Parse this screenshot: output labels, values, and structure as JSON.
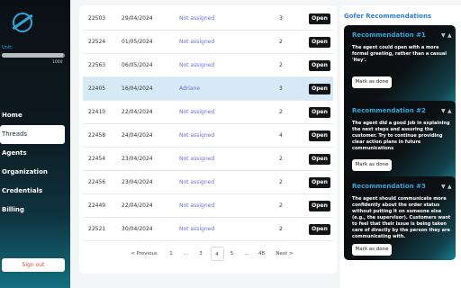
{
  "sidebar": {
    "unit_label": "Unit:",
    "unit_fill": 0.97,
    "unit_max": "1000",
    "items": [
      {
        "label": "Home",
        "active": false
      },
      {
        "label": "Threads",
        "active": true
      },
      {
        "label": "Agents",
        "active": false
      },
      {
        "label": "Organization",
        "active": false
      },
      {
        "label": "Credentials",
        "active": false
      },
      {
        "label": "Billing",
        "active": false
      }
    ],
    "signout_label": "Sign out"
  },
  "table": {
    "open_label": "Open",
    "rows": [
      {
        "id": "22503",
        "date": "29/04/2024",
        "agent": "Not assigned",
        "count": "3",
        "highlight": false
      },
      {
        "id": "22524",
        "date": "01/05/2024",
        "agent": "Not assigned",
        "count": "2",
        "highlight": false
      },
      {
        "id": "22563",
        "date": "06/05/2024",
        "agent": "Not assigned",
        "count": "2",
        "highlight": false
      },
      {
        "id": "22405",
        "date": "16/04/2024",
        "agent": "Adriane",
        "count": "3",
        "highlight": true
      },
      {
        "id": "22410",
        "date": "22/04/2024",
        "agent": "Not assigned",
        "count": "2",
        "highlight": false
      },
      {
        "id": "22458",
        "date": "24/04/2024",
        "agent": "Not assigned",
        "count": "4",
        "highlight": false
      },
      {
        "id": "22454",
        "date": "23/04/2024",
        "agent": "Not assigned",
        "count": "2",
        "highlight": false
      },
      {
        "id": "22456",
        "date": "23/04/2024",
        "agent": "Not assigned",
        "count": "2",
        "highlight": false
      },
      {
        "id": "22449",
        "date": "22/04/2024",
        "agent": "Not assigned",
        "count": "2",
        "highlight": false
      },
      {
        "id": "22521",
        "date": "30/04/2024",
        "agent": "Not assigned",
        "count": "2",
        "highlight": false
      }
    ]
  },
  "pagination": {
    "previous": "< Previous",
    "next": "Next >",
    "pages": [
      "1",
      "...",
      "3",
      "4",
      "5",
      "...",
      "48"
    ],
    "current": "4"
  },
  "recommendations": {
    "heading": "Gofer Recommendations",
    "button_label": "Mark as done",
    "items": [
      {
        "title": "Recommendation #1",
        "text": "The agent could open with a more formal greeting, rather than a casual 'Hey'."
      },
      {
        "title": "Recommendation #2",
        "text": "The agent did a good job in explaining the next steps and assuring the customer. Try to continue providing clear action plans in future communications"
      },
      {
        "title": "Recommendation #3",
        "text": "The agent should communicate more confidently about the order status without putting it on someone else (e.g., the supervisor). Customers want to feel that their issue is being taken care of directly by the person they are communicating with."
      }
    ]
  },
  "colors": {
    "accent": "#2aa9df",
    "agent_link": "#6b6fd6",
    "highlight_row": "#d6e9f7",
    "signout": "#e0463a"
  }
}
